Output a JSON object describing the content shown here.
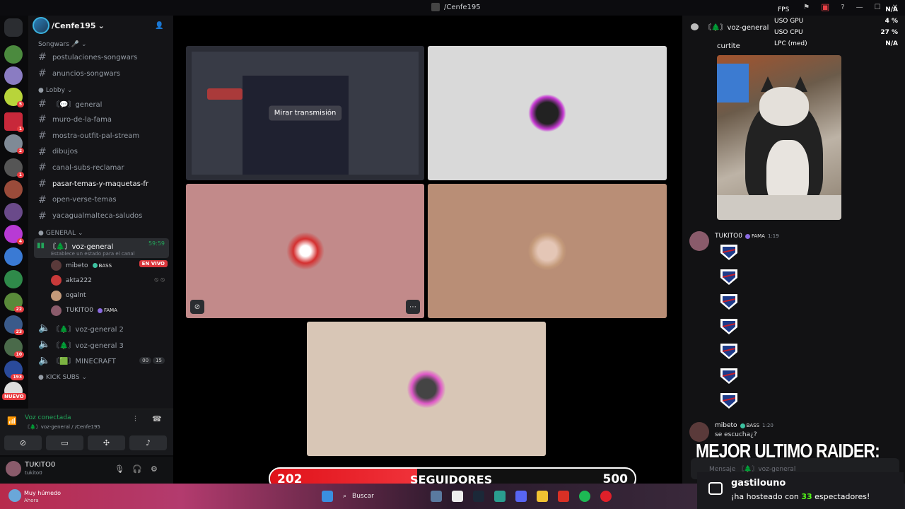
{
  "window": {
    "title": "/Cenfe195"
  },
  "overlay_stats": {
    "fps_label": "FPS",
    "fps_value": "N/A",
    "gpu_label": "USO GPU",
    "gpu_value": "4 %",
    "cpu_label": "USO CPU",
    "cpu_value": "27 %",
    "lpc_label": "LPC (med)",
    "lpc_value": "N/A"
  },
  "server": {
    "name": "/Cenfe195"
  },
  "rail": {
    "badges": [
      "5",
      "1",
      "2",
      "1",
      "4",
      "22",
      "23",
      "10",
      "193"
    ],
    "nuevo": "NUEVO"
  },
  "categories": {
    "songwars": "Songwars 🎤",
    "lobby": "Lobby",
    "general": "GENERAL",
    "kick_subs": "KICK SUBS"
  },
  "channels_songwars": [
    {
      "name": "postulaciones-songwars"
    },
    {
      "name": "anuncios-songwars"
    }
  ],
  "channels_lobby": [
    {
      "name": "〘💬〙general"
    },
    {
      "name": "muro-de-la-fama"
    },
    {
      "name": "mostra-outfit-pal-stream"
    },
    {
      "name": "dibujos"
    },
    {
      "name": "canal-subs-reclamar"
    },
    {
      "name": "pasar-temas-y-maquetas-fr"
    },
    {
      "name": "open-verse-temas"
    },
    {
      "name": "yacagualmalteca-saludos"
    }
  ],
  "voice_active": {
    "name": "〘🌲〙voz-general",
    "sub": "Establece un estado para el canal",
    "time": "59:59"
  },
  "voice_users": [
    {
      "name": "mibeto",
      "tag": "BASS",
      "live": "EN VIVO"
    },
    {
      "name": "akta222"
    },
    {
      "name": "ogalnt"
    },
    {
      "name": "TUKITO0",
      "tag": "FAMA"
    }
  ],
  "voice_channels": [
    {
      "name": "〘🌲〙voz-general 2"
    },
    {
      "name": "〘🌲〙voz-general 3"
    },
    {
      "name": "〘🟩〙MINECRAFT",
      "count_a": "00",
      "count_b": "15"
    }
  ],
  "voice_connection": {
    "status": "Voz conectada",
    "where": "〘🌲〙voz-general / /Cenfe195"
  },
  "user": {
    "name": "TUKITO0",
    "tag": "tukito0"
  },
  "stage": {
    "watch_label": "Mirar transmisión"
  },
  "followers": {
    "current": "202",
    "label": "SEGUIDORES",
    "goal": "500",
    "fraction": 0.404
  },
  "chat": {
    "channel": "〘🌲〙voz-general",
    "first_author": "curtite",
    "messages": [
      {
        "author": "TUKITO0",
        "tag": "FAMA",
        "time": "1:19"
      },
      {
        "author": "mibeto",
        "tag": "BASS",
        "time": "1:20",
        "text": "se escucha¿?"
      }
    ],
    "input_placeholder": "Mensaje 〘🌲〙voz-general"
  },
  "raider": {
    "heading": "MEJOR ULTIMO RAIDER:",
    "name": "gastilouno",
    "msg_prefix": "¡ha hosteado con ",
    "count": "33",
    "msg_suffix": " espectadores!"
  },
  "taskbar": {
    "weather": "Muy húmedo",
    "weather_sub": "Ahora",
    "search": "Buscar"
  }
}
